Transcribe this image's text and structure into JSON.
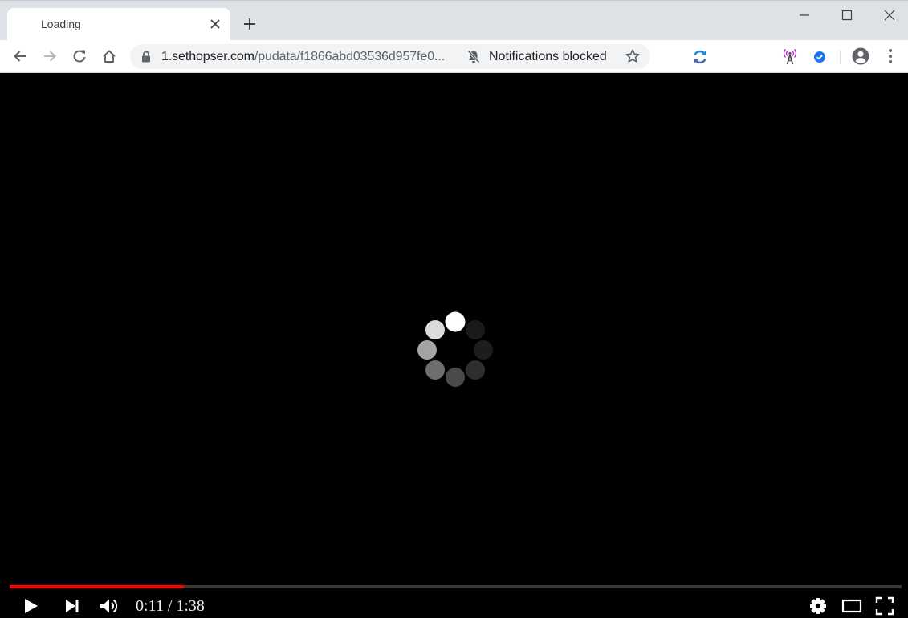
{
  "tab": {
    "title": "Loading"
  },
  "address_bar": {
    "url_host": "1.sethopser.com",
    "url_path": "/pudata/f1866abd03536d957fe0...",
    "notification_status": "Notifications blocked"
  },
  "icons": {
    "back": "arrow-left-icon",
    "forward": "arrow-right-icon",
    "reload": "reload-icon",
    "home": "home-icon",
    "lock": "lock-icon",
    "notifications": "bell-off-icon",
    "bookmark": "star-icon",
    "extensions": [
      "sync-extension-icon",
      "tower-extension-icon",
      "check-extension-icon"
    ],
    "profile": "account-icon",
    "menu": "more-vert-icon"
  },
  "player": {
    "status": "buffering",
    "progress_fraction": 0.195,
    "current_time": "0:11",
    "duration": "1:38",
    "time_display": "0:11 / 1:38"
  },
  "colors": {
    "progress": "#ff0000",
    "tabstrip": "#dee1e6",
    "check_extension": "#1a73e8",
    "tower_extension": "#9c27b0"
  }
}
